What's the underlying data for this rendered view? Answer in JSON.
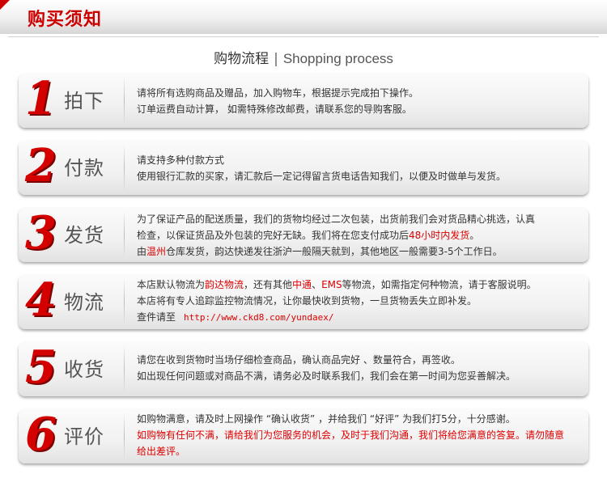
{
  "header": {
    "title": "购买须知"
  },
  "section": {
    "title_cn": "购物流程",
    "separator": "|",
    "title_en": "Shopping process"
  },
  "steps": [
    {
      "number": "1",
      "name": "拍下",
      "lines": [
        "请将所有选购商品及赠品，加入购物车，根据提示完成拍下操作。",
        "订单运费自动计算，  如需特殊修改邮费，请联系您的导购客服。"
      ]
    },
    {
      "number": "2",
      "name": "付款",
      "lines": [
        "请支持多种付款方式",
        "使用银行汇款的买家，请汇款后一定记得留言货电话告知我们，以便及时做单与发货。"
      ]
    },
    {
      "number": "3",
      "name": "发货",
      "line1": "为了保证产品的配送质量，我们的货物均经过二次包装，出货前我们会对货品精心挑选，认真",
      "line2_a": "检查，以保证货品及外包装的完好无缺。我们将在您支付成功后",
      "line2_red": "48小时内发货",
      "line2_b": "。",
      "line3_a": "由",
      "line3_red": "温州",
      "line3_b": "仓库发货，韵达快递发往浙沪一般隔天就到，其他地区一般需要3-5个工作日。"
    },
    {
      "number": "4",
      "name": "物流",
      "line1_a": "本店默认物流为",
      "line1_red1": "韵达物流",
      "line1_b": "，还有其他",
      "line1_red2": "中通",
      "line1_c": "、",
      "line1_red3": "EMS",
      "line1_d": "等物流，如需指定何种物流，请于客服说明。",
      "line2": "本店将有专人追踪监控物流情况，让你最快收到货物，一旦货物丢失立即补发。",
      "line3_label": "查件请至",
      "line3_link": "http://www.ckd8.com/yundaex/"
    },
    {
      "number": "5",
      "name": "收货",
      "lines": [
        "请您在收到货物时当场仔细检查商品，确认商品完好 、数量符合，再签收。",
        "如出现任何问题或对商品不满，请务必及时联系我们，我们会在第一时间为您妥善解决。"
      ]
    },
    {
      "number": "6",
      "name": "评价",
      "line1": "如购物满意，请及时上网操作 “确认收货” ，并给我们 “好评” 为我们打5分，十分感谢。",
      "line2_red": "如购物有任何不满，请给我们为您服务的机会，及时于我们沟通，我们将给您满意的答复。请勿随意",
      "line3_red": "给出差评。"
    }
  ],
  "colors": {
    "accent": "#cc0000",
    "number_red": "#d40000",
    "text": "#333333"
  }
}
